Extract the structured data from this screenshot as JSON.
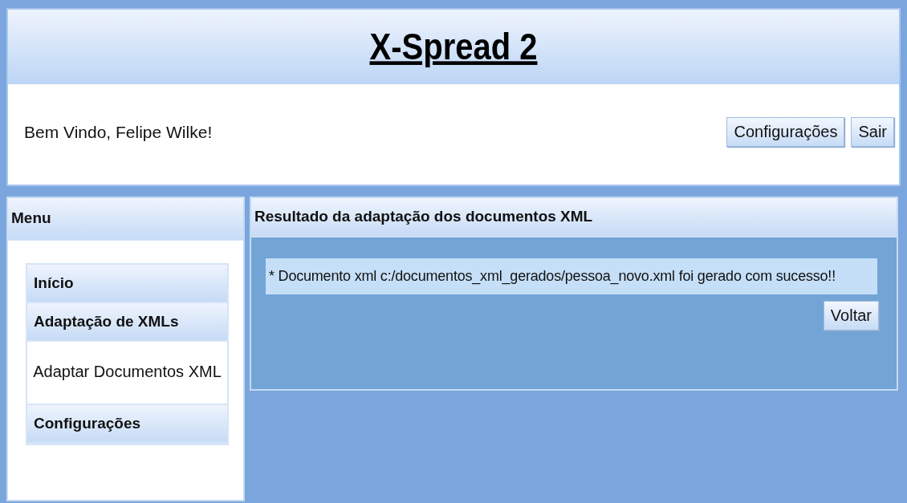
{
  "header": {
    "title": "X-Spread 2",
    "welcome": "Bem Vindo, Felipe Wilke!",
    "buttons": [
      "Configurações",
      "Sair"
    ]
  },
  "menu": {
    "title": "Menu",
    "items": [
      {
        "label": "Início"
      },
      {
        "label": "Adaptação de XMLs",
        "children": [
          {
            "label": "Adaptar Documentos XML"
          }
        ]
      },
      {
        "label": "Configurações"
      }
    ]
  },
  "result": {
    "title": "Resultado da adaptação dos documentos XML",
    "message": "* Documento xml c:/documentos_xml_gerados/pessoa_novo.xml foi gerado com sucesso!!",
    "button": "Voltar"
  }
}
